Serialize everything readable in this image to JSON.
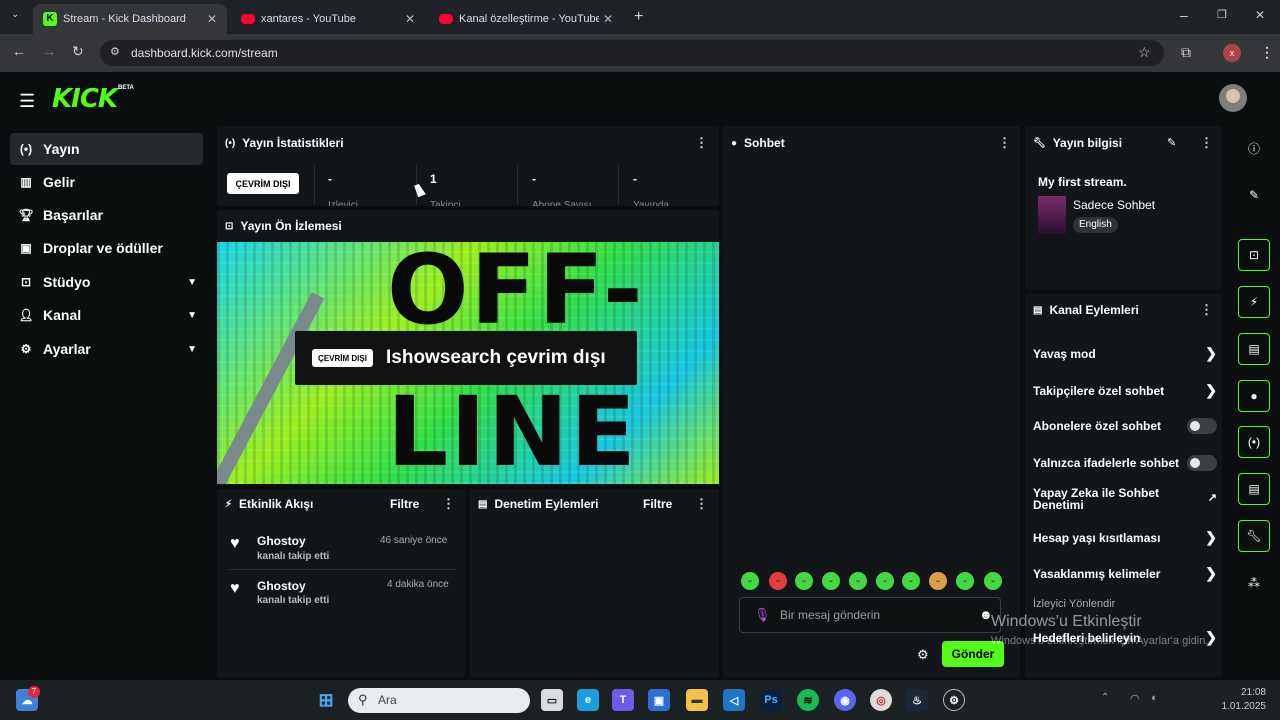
{
  "browser": {
    "tabs": [
      {
        "label": "Stream - Kick Dashboard",
        "color": "#53fc18"
      },
      {
        "label": "xantares - YouTube",
        "color": "#ff0033"
      },
      {
        "label": "Kanal özelleştirme - YouTube St",
        "color": "#ff0033"
      }
    ],
    "url": "dashboard.kick.com/stream",
    "profile_initial": "x"
  },
  "app": {
    "logo": "KICK",
    "beta": "BETA",
    "sidebar": [
      {
        "label": "Yayın",
        "icon": "broadcast-icon"
      },
      {
        "label": "Gelir",
        "icon": "chart-icon"
      },
      {
        "label": "Başarılar",
        "icon": "trophy-icon"
      },
      {
        "label": "Droplar ve ödüller",
        "icon": "gift-icon"
      },
      {
        "label": "Stüdyo",
        "icon": "studio-icon"
      },
      {
        "label": "Kanal",
        "icon": "user-icon"
      },
      {
        "label": "Ayarlar",
        "icon": "gear-icon"
      }
    ],
    "stats": {
      "title": "Yayın İstatistikleri",
      "offline": "ÇEVRİM DIŞI",
      "items": [
        {
          "value": "-",
          "label": "İzleyici"
        },
        {
          "value": "1",
          "label": "Takipçi"
        },
        {
          "value": "-",
          "label": "Abone Sayısı"
        },
        {
          "value": "-",
          "label": "Yayında"
        }
      ]
    },
    "preview": {
      "title": "Yayın Ön İzlemesi",
      "badge": "ÇEVRİM DIŞI",
      "text": "Ishowsearch çevrim dışı",
      "bg_top": "OFF-",
      "bg_bottom": "LINE"
    },
    "activity": {
      "title": "Etkinlik Akışı",
      "filter": "Filtre",
      "items": [
        {
          "name": "Ghostoy",
          "time": "46 saniye önce",
          "desc": "kanalı takip etti"
        },
        {
          "name": "Ghostoy",
          "time": "4 dakika önce",
          "desc": "kanalı takip etti"
        }
      ]
    },
    "moderation": {
      "title": "Denetim Eylemleri",
      "filter": "Filtre"
    },
    "chat": {
      "title": "Sohbet",
      "placeholder": "Bir mesaj gönderin",
      "send": "Gönder"
    },
    "info": {
      "title": "Yayın bilgisi",
      "stream_title": "My first stream.",
      "category": "Sadece Sohbet",
      "language": "English"
    },
    "actions": {
      "title": "Kanal Eylemleri",
      "items": [
        {
          "label": "Yavaş mod",
          "type": "arrow"
        },
        {
          "label": "Takipçilere özel sohbet",
          "type": "arrow"
        },
        {
          "label": "Abonelere özel sohbet",
          "type": "toggle"
        },
        {
          "label": "Yalnızca ifadelerle sohbet",
          "type": "toggle"
        },
        {
          "label": "Yapay Zeka ile Sohbet Denetimi",
          "type": "external"
        },
        {
          "label": "Hesap yaşı kısıtlaması",
          "type": "arrow"
        },
        {
          "label": "Yasaklanmış kelimeler",
          "type": "arrow"
        },
        {
          "label": "İzleyici Yönlendir",
          "type": "none"
        },
        {
          "label": "Hedefleri belirleyin",
          "type": "arrow"
        }
      ]
    }
  },
  "watermark": {
    "line1": "Windows'u Etkinleştir",
    "line2": "Windows'u etkinleştirmek için Ayarlar'a gidin."
  },
  "taskbar": {
    "search": "Ara",
    "weather_badge": "7",
    "time": "21:08",
    "date": "1.01.2025"
  },
  "colors": {
    "accent": "#53fc18",
    "panel": "#131618",
    "background": "#0b0e0f"
  }
}
